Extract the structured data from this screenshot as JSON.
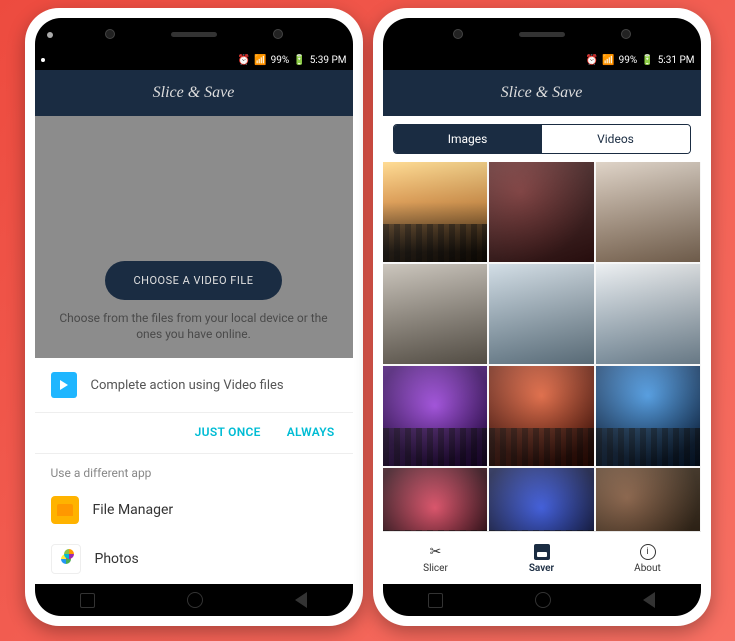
{
  "statusbar": {
    "signal": "99%",
    "time_left": "5:39 PM",
    "time_right": "5:31 PM"
  },
  "app": {
    "title": "Slice & Save"
  },
  "phone1": {
    "choose_button": "CHOOSE A VIDEO FILE",
    "choose_desc": "Choose from the files from your local device or the ones you have online.",
    "sheet_title": "Complete action using Video files",
    "just_once": "JUST ONCE",
    "always": "ALWAYS",
    "alt_label": "Use a different app",
    "apps": [
      {
        "name": "File Manager"
      },
      {
        "name": "Photos"
      }
    ]
  },
  "phone2": {
    "tabs": {
      "images": "Images",
      "videos": "Videos"
    },
    "bottom": {
      "slicer": "Slicer",
      "saver": "Saver",
      "about": "About"
    }
  }
}
